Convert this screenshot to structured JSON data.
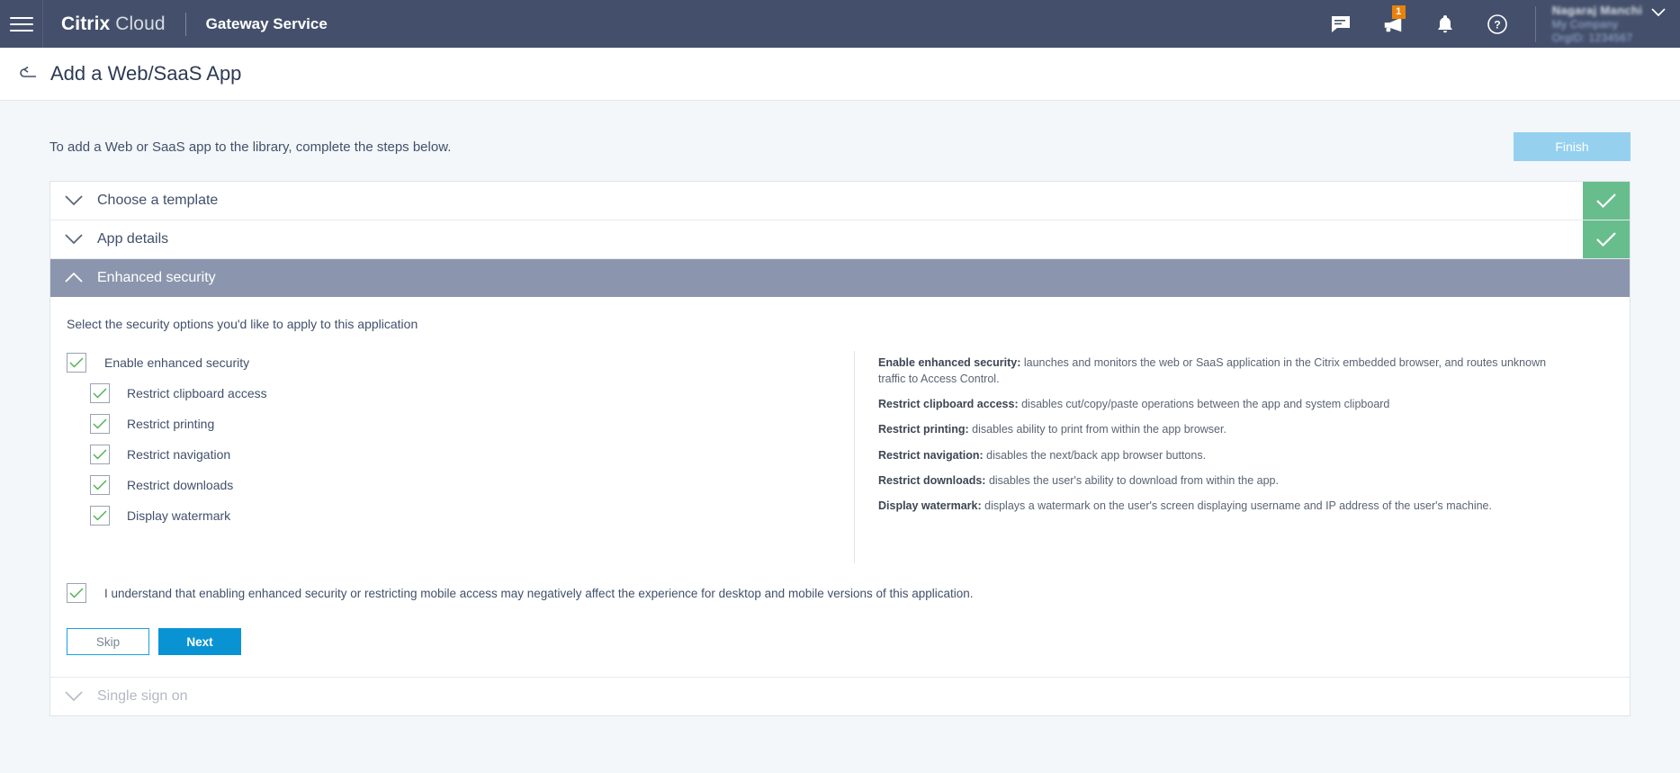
{
  "topbar": {
    "menu_icon": "hamburger-icon",
    "brand_primary": "Citrix",
    "brand_secondary": "Cloud",
    "service_name": "Gateway Service",
    "icons": [
      {
        "name": "feedback-icon",
        "badge": null
      },
      {
        "name": "announcements-megaphone-icon",
        "badge": "1"
      },
      {
        "name": "notifications-bell-icon",
        "badge": null
      },
      {
        "name": "help-question-icon",
        "badge": null
      }
    ],
    "user": {
      "name": "Nagaraj Manchi",
      "line2": "My Company",
      "line3": "OrgID: 1234567",
      "chevron": "chevron-down-icon"
    }
  },
  "titlebar": {
    "back_icon": "back-arrow-icon",
    "title": "Add a Web/SaaS App"
  },
  "intro": {
    "text": "To add a Web or SaaS app to the library, complete the steps below.",
    "finish_label": "Finish"
  },
  "accordion": {
    "sections": [
      {
        "label": "Choose a template",
        "state": "collapsed",
        "complete": true,
        "disabled": false,
        "chevron": "chevron-down-icon"
      },
      {
        "label": "App details",
        "state": "collapsed",
        "complete": true,
        "disabled": false,
        "chevron": "chevron-down-icon"
      },
      {
        "label": "Enhanced security",
        "state": "expanded",
        "complete": false,
        "disabled": false,
        "chevron": "chevron-up-icon"
      },
      {
        "label": "Single sign on",
        "state": "collapsed",
        "complete": false,
        "disabled": true,
        "chevron": "chevron-down-icon"
      }
    ]
  },
  "security_panel": {
    "subtitle": "Select the security options you'd like to apply to this application",
    "options": [
      {
        "label": "Enable enhanced security",
        "checked": true,
        "indent": false
      },
      {
        "label": "Restrict clipboard access",
        "checked": true,
        "indent": true
      },
      {
        "label": "Restrict printing",
        "checked": true,
        "indent": true
      },
      {
        "label": "Restrict navigation",
        "checked": true,
        "indent": true
      },
      {
        "label": "Restrict downloads",
        "checked": true,
        "indent": true
      },
      {
        "label": "Display watermark",
        "checked": true,
        "indent": true
      }
    ],
    "help": [
      {
        "term": "Enable enhanced security:",
        "desc": " launches and monitors the web or SaaS application in the Citrix embedded browser, and routes unknown traffic to Access Control."
      },
      {
        "term": "Restrict clipboard access:",
        "desc": " disables cut/copy/paste operations between the app and system clipboard"
      },
      {
        "term": "Restrict printing:",
        "desc": " disables ability to print from within the app browser."
      },
      {
        "term": "Restrict navigation:",
        "desc": " disables the next/back app browser buttons."
      },
      {
        "term": "Restrict downloads:",
        "desc": " disables the user's ability to download from within the app."
      },
      {
        "term": "Display watermark:",
        "desc": " displays a watermark on the user's screen displaying username and IP address of the user's machine."
      }
    ],
    "acknowledgement": {
      "checked": true,
      "label": "I understand that enabling enhanced security or restricting mobile access may negatively affect the experience for desktop and mobile versions of this application."
    },
    "buttons": {
      "skip_label": "Skip",
      "next_label": "Next"
    }
  },
  "colors": {
    "topbar_bg": "#44506b",
    "page_bg": "#f3f7fa",
    "active_section_bg": "#8b96ae",
    "complete_badge": "#68bd8d",
    "primary_button": "#0a93d3",
    "finish_disabled": "#95d0ef",
    "badge_orange": "#e8820c",
    "check_green": "#4caf50"
  }
}
